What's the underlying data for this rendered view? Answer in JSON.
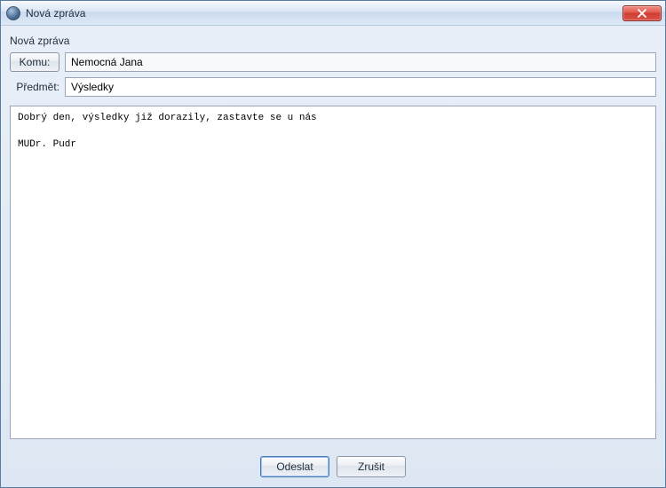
{
  "window": {
    "title": "Nová zpráva"
  },
  "header": {
    "section_label": "Nová zpráva"
  },
  "fields": {
    "to_button_label": "Komu:",
    "to_value": "Nemocná Jana",
    "subject_label": "Předmět:",
    "subject_value": "Výsledky"
  },
  "body": {
    "text": "Dobrý den, výsledky již dorazily, zastavte se u nás\n\nMUDr. Pudr"
  },
  "footer": {
    "send_label": "Odeslat",
    "cancel_label": "Zrušit"
  }
}
